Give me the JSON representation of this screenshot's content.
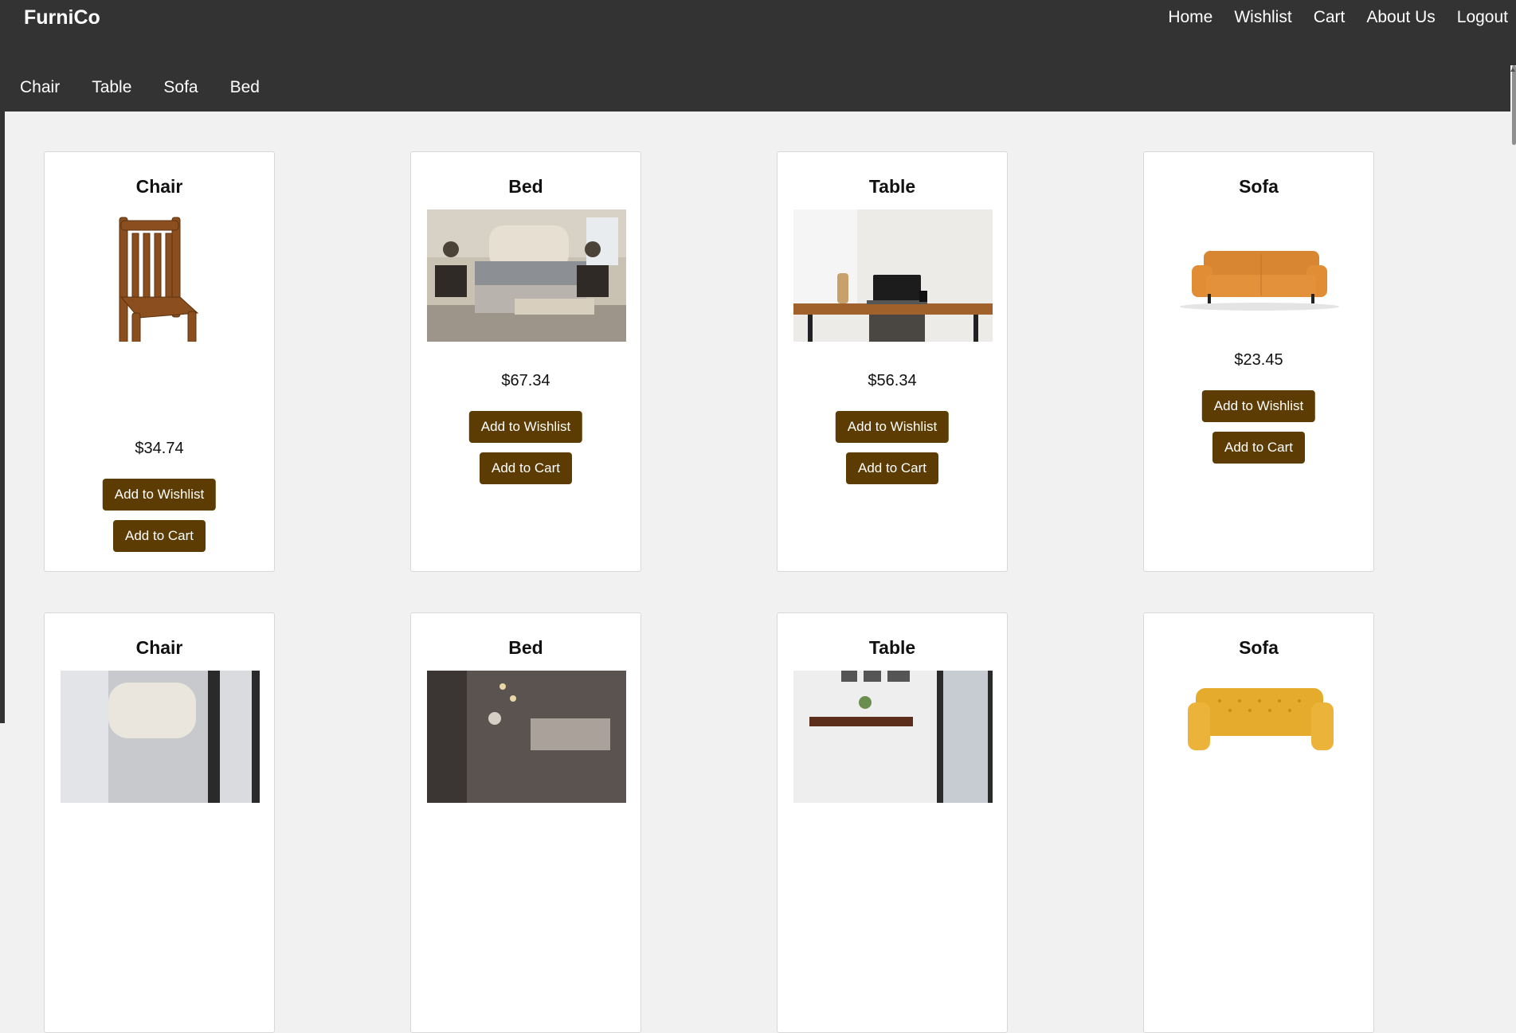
{
  "header": {
    "logo": "FurniCo",
    "nav": [
      "Home",
      "Wishlist",
      "Cart",
      "About Us",
      "Logout"
    ],
    "categories": [
      "Chair",
      "Table",
      "Sofa",
      "Bed"
    ]
  },
  "products": [
    {
      "title": "Chair",
      "price": "$34.74",
      "wishlist_label": "Add to Wishlist",
      "cart_label": "Add to Cart"
    },
    {
      "title": "Bed",
      "price": "$67.34",
      "wishlist_label": "Add to Wishlist",
      "cart_label": "Add to Cart"
    },
    {
      "title": "Table",
      "price": "$56.34",
      "wishlist_label": "Add to Wishlist",
      "cart_label": "Add to Cart"
    },
    {
      "title": "Sofa",
      "price": "$23.45",
      "wishlist_label": "Add to Wishlist",
      "cart_label": "Add to Cart"
    },
    {
      "title": "Chair"
    },
    {
      "title": "Bed"
    },
    {
      "title": "Table"
    },
    {
      "title": "Sofa"
    }
  ],
  "colors": {
    "header_bg": "#333333",
    "page_bg": "#f1f1f1",
    "button_bg": "#5c3c03",
    "button_text": "#ffffff"
  }
}
